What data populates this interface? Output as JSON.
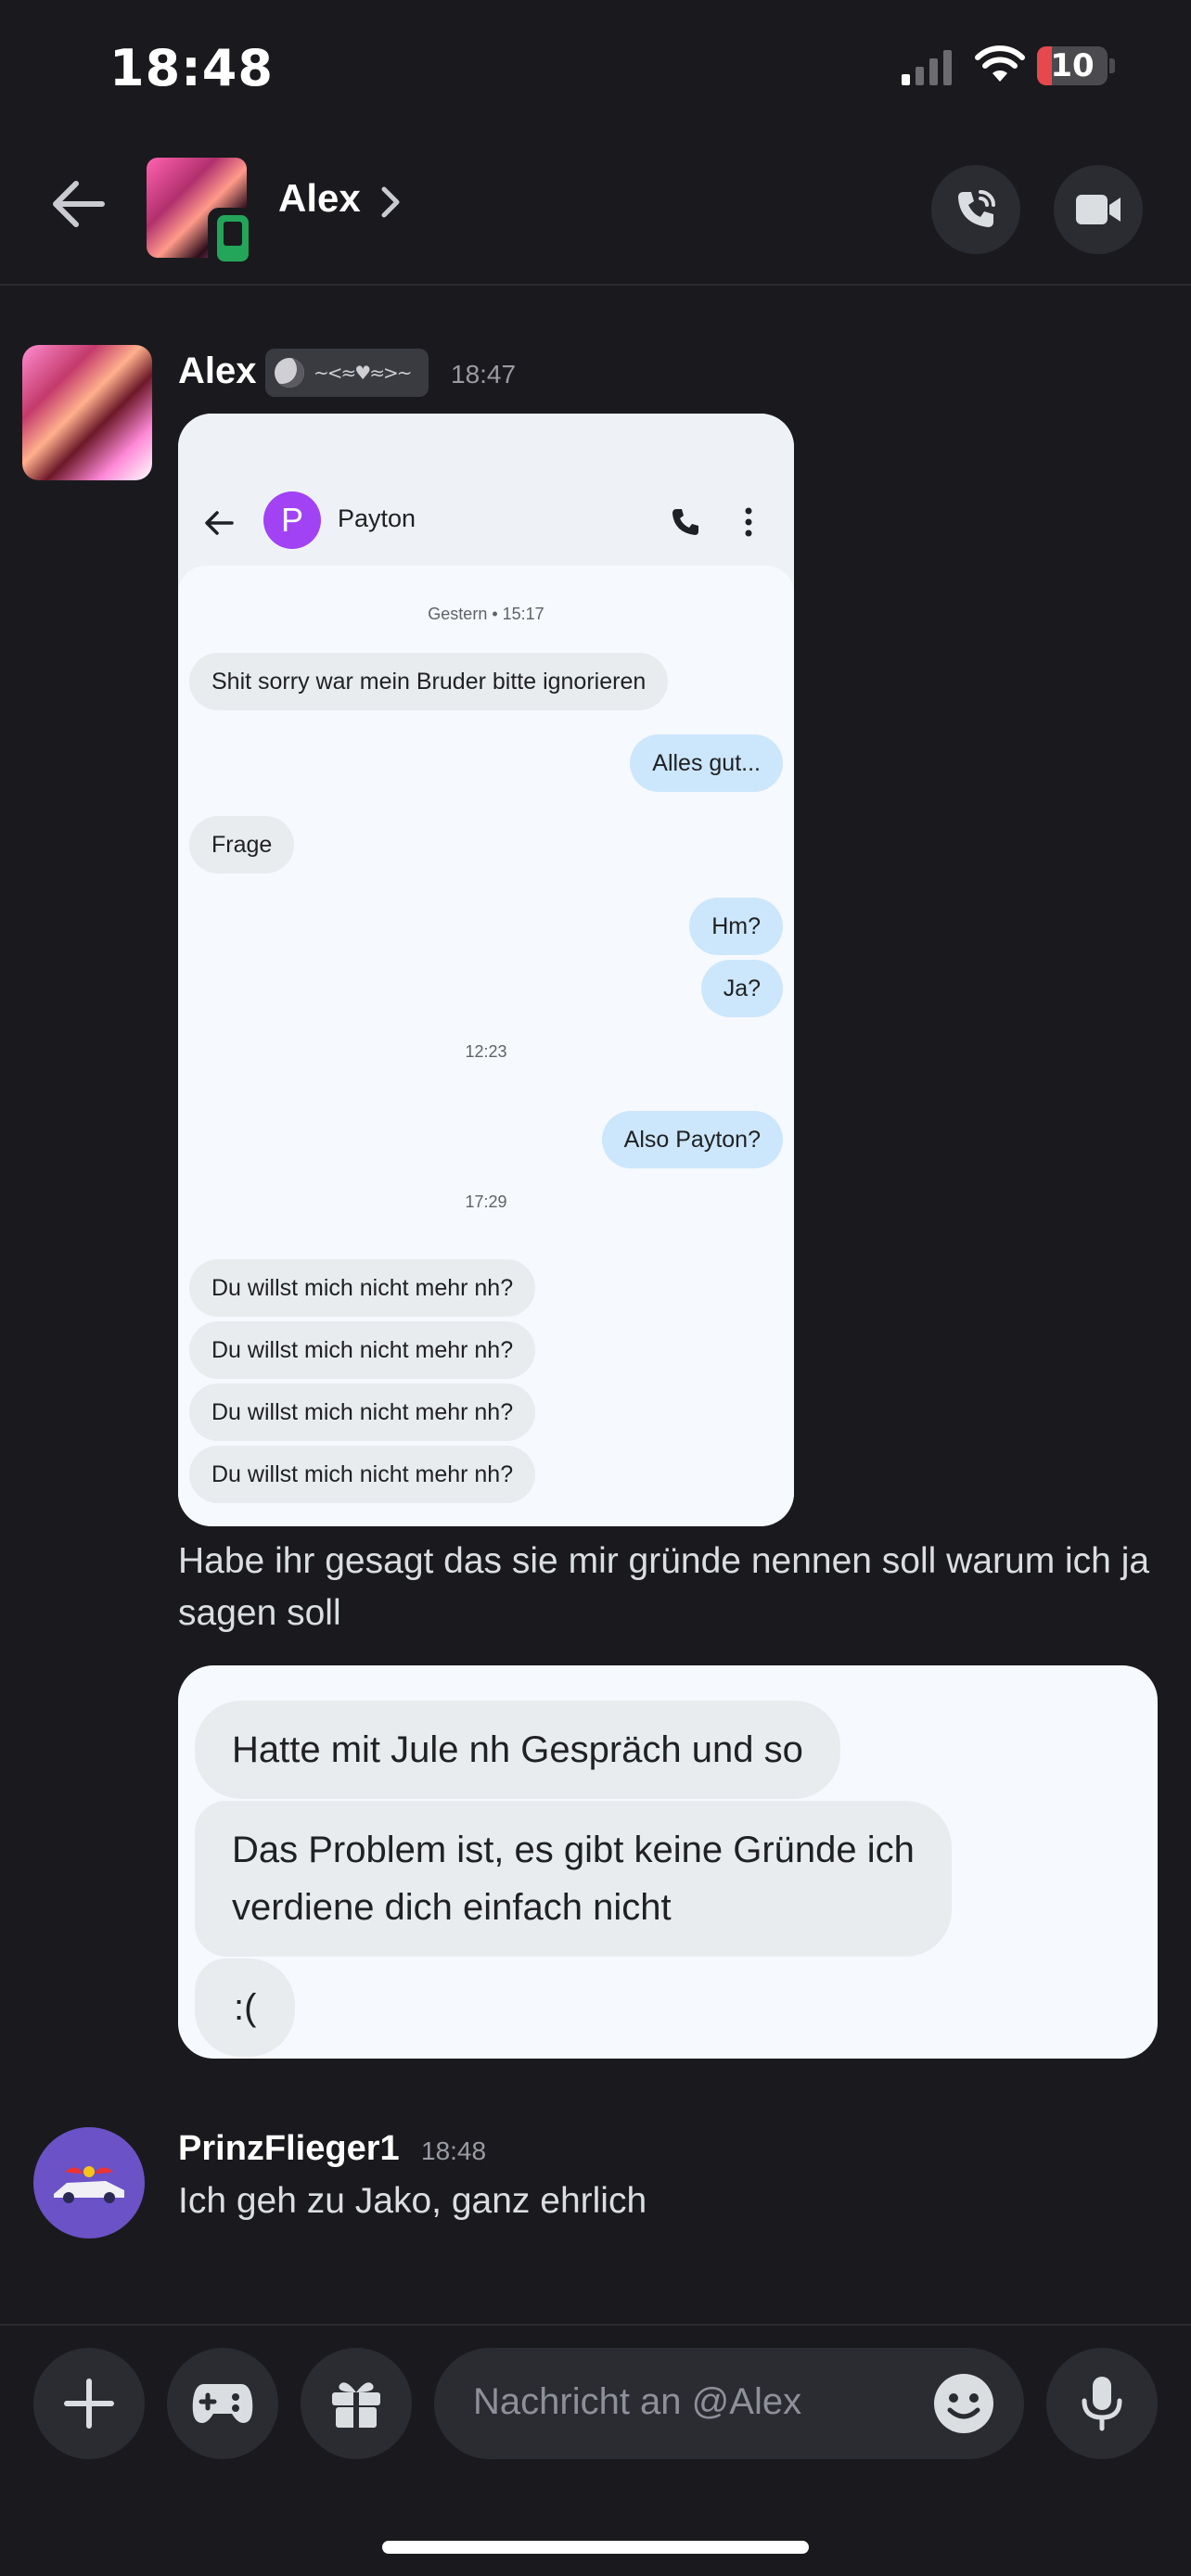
{
  "status_bar": {
    "time": "18:48",
    "battery": "10",
    "battery_level_percent": 10
  },
  "header": {
    "contact_name": "Alex"
  },
  "messages": [
    {
      "author": "Alex",
      "time": "18:47",
      "embedded_screenshot": {
        "contact": "Payton",
        "avatar_letter": "P",
        "items": [
          {
            "kind": "date",
            "text": "Gestern • 15:17"
          },
          {
            "kind": "in",
            "text": "Shit sorry war mein Bruder bitte ignorieren"
          },
          {
            "kind": "out",
            "text": "Alles gut..."
          },
          {
            "kind": "in",
            "text": "Frage"
          },
          {
            "kind": "out",
            "text": "Hm?"
          },
          {
            "kind": "out",
            "text": "Ja?"
          },
          {
            "kind": "date",
            "text": "12:23"
          },
          {
            "kind": "out",
            "text": "Also Payton?"
          },
          {
            "kind": "date",
            "text": "17:29"
          },
          {
            "kind": "in",
            "text": "Du willst mich nicht mehr nh?"
          },
          {
            "kind": "in",
            "text": "Du willst mich nicht mehr nh?"
          },
          {
            "kind": "in",
            "text": "Du willst mich nicht mehr nh?"
          },
          {
            "kind": "in",
            "text": "Du willst mich nicht mehr nh?"
          }
        ]
      },
      "text": "Habe ihr gesagt das sie mir gründe nennen soll warum ich ja sagen soll",
      "embedded_bubbles": [
        {
          "line1": "Hatte mit Jule nh Gespräch und so",
          "line2": ""
        },
        {
          "line1": "Das Problem ist, es gibt keine Gründe ich",
          "line2": "verdiene dich einfach nicht"
        },
        {
          "line1": ":(",
          "line2": ""
        }
      ]
    },
    {
      "author": "PrinzFlieger1",
      "time": "18:48",
      "text": "Ich geh zu Jako, ganz ehrlich"
    }
  ],
  "composer": {
    "placeholder": "Nachricht an @Alex"
  },
  "colors": {
    "background": "#1a1a1e",
    "surface": "#2b2c31",
    "avatar_purple": "#6b52c6",
    "online_green": "#23a55a",
    "out_bubble": "#cce7fb"
  }
}
